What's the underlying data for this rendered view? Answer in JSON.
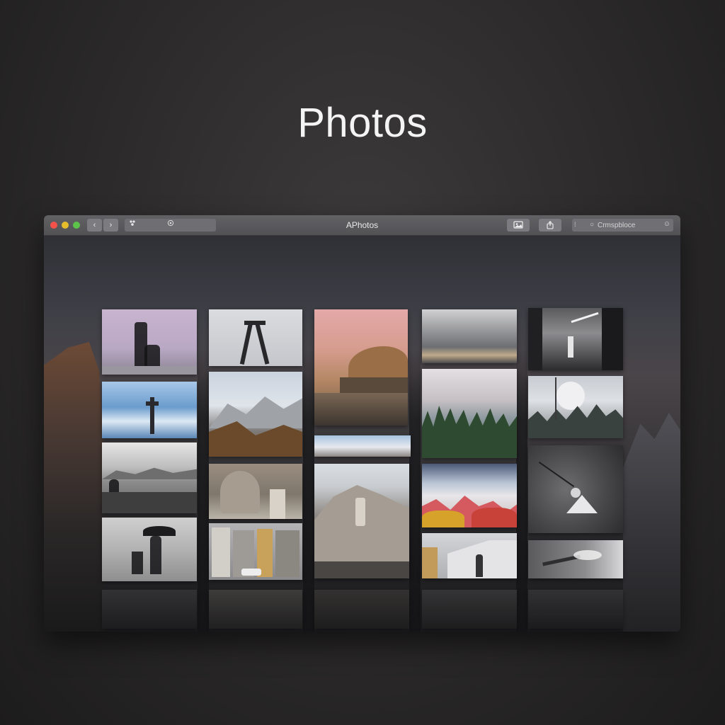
{
  "page": {
    "heading": "Photos"
  },
  "window": {
    "title": "APhotos",
    "nav_back_glyph": "‹",
    "nav_forward_glyph": "›",
    "toolbar_segment_icons": [
      "people-icon",
      "tag-icon"
    ],
    "toolbar_buttons": [
      {
        "name": "photo-view-icon",
        "glyph": "▣"
      },
      {
        "name": "share-icon",
        "glyph": "⇧"
      }
    ],
    "search": {
      "placeholder": "Crmspbloce",
      "left_glyph": "⁞",
      "icon_glyph": "○",
      "right_glyph": "☺"
    }
  },
  "colors": {
    "close": "#f2524a",
    "minimize": "#e6be2c",
    "maximize": "#5dc24a",
    "titlebar": "#58585b",
    "background": "#2e2c2c"
  },
  "photos": [
    {
      "col": 1,
      "subject": "statue-figure-pink-sky"
    },
    {
      "col": 1,
      "subject": "ocean-wave-rock-figure"
    },
    {
      "col": 1,
      "subject": "bw-mountain-shore-figure"
    },
    {
      "col": 1,
      "subject": "bw-umbrella-person"
    },
    {
      "col": 2,
      "subject": "crane-structure-grey-sky"
    },
    {
      "col": 2,
      "subject": "snowy-mountains"
    },
    {
      "col": 2,
      "subject": "trees-road"
    },
    {
      "col": 2,
      "subject": "city-street"
    },
    {
      "col": 3,
      "subject": "rock-dome-pink-sunset"
    },
    {
      "col": 3,
      "subject": "coastal-strip"
    },
    {
      "col": 3,
      "subject": "rocky-summit"
    },
    {
      "col": 4,
      "subject": "cloudy-sky-landscape"
    },
    {
      "col": 4,
      "subject": "pine-forest-misty"
    },
    {
      "col": 4,
      "subject": "autumn-trees-clouds"
    },
    {
      "col": 4,
      "subject": "building-street-figures"
    },
    {
      "col": 5,
      "subject": "bw-night-figure"
    },
    {
      "col": 5,
      "subject": "misty-forest-moon"
    },
    {
      "col": 5,
      "subject": "bw-textured-ground-figure"
    },
    {
      "col": 5,
      "subject": "bird-in-flight"
    }
  ]
}
